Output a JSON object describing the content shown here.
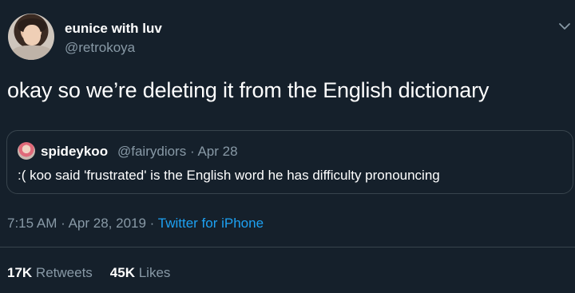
{
  "author": {
    "display_name": "eunice with luv",
    "handle": "@retrokoya"
  },
  "tweet": {
    "text": "okay so we’re deleting it from the English dictionary",
    "time": "7:15 AM",
    "date": "Apr 28, 2019",
    "source": "Twitter for iPhone",
    "separator": "·"
  },
  "quoted_tweet": {
    "display_name": "spideykoo",
    "handle": "@fairydiors",
    "date": "Apr 28",
    "separator": "·",
    "text": ":( koo said 'frustrated' is the English word he has difficulty pronouncing"
  },
  "stats": {
    "retweets_count": "17K",
    "retweets_label": "Retweets",
    "likes_count": "45K",
    "likes_label": "Likes"
  },
  "icons": {
    "menu": "chevron-down-icon"
  },
  "colors": {
    "background": "#15202b",
    "secondary_text": "#8899a6",
    "link": "#1da1f2",
    "border": "#38444d"
  }
}
